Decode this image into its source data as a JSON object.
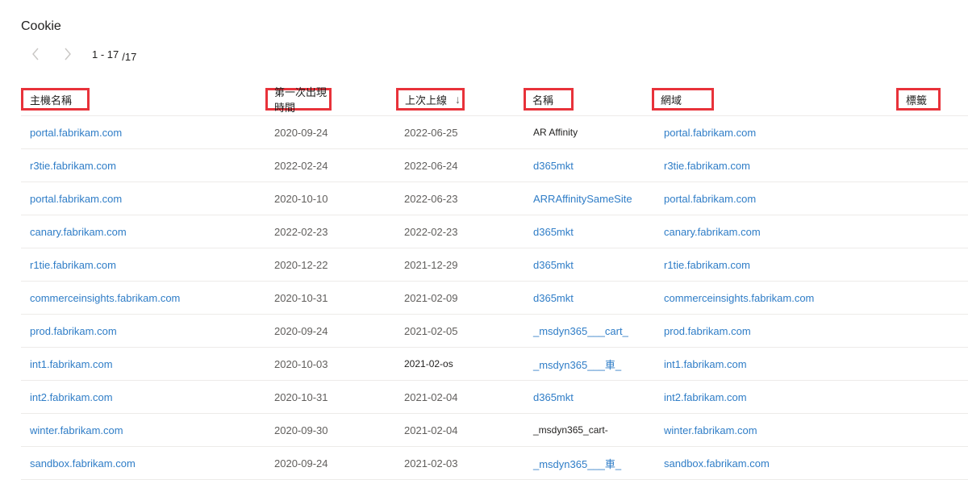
{
  "title": "Cookie",
  "pager": {
    "range": "1 - 17",
    "total": "/17"
  },
  "columns": {
    "host": "主機名稱",
    "first_seen": "第一次出現時間",
    "last_seen": "上次上線",
    "name": "名稱",
    "domain": "網域",
    "tags": "標籤"
  },
  "sort_indicator": "↓",
  "rows": [
    {
      "host": "portal.fabrikam.com",
      "first_seen": "2020-09-24",
      "last_seen": "2022-06-25",
      "name": "AR Affinity",
      "domain": "portal.fabrikam.com"
    },
    {
      "host": "r3tie.fabrikam.com",
      "first_seen": "2022-02-24",
      "last_seen": "2022-06-24",
      "name": "d365mkt",
      "domain": "r3tie.fabrikam.com"
    },
    {
      "host": "portal.fabrikam.com",
      "first_seen": "2020-10-10",
      "last_seen": "2022-06-23",
      "name": "ARRAffinitySameSite",
      "domain": "portal.fabrikam.com"
    },
    {
      "host": "canary.fabrikam.com",
      "first_seen": "2022-02-23",
      "last_seen": "2022-02-23",
      "name": "d365mkt",
      "domain": "canary.fabrikam.com"
    },
    {
      "host": "r1tie.fabrikam.com",
      "first_seen": "2020-12-22",
      "last_seen": "2021-12-29",
      "name": "d365mkt",
      "domain": "r1tie.fabrikam.com"
    },
    {
      "host": "commerceinsights.fabrikam.com",
      "first_seen": "2020-10-31",
      "last_seen": "2021-02-09",
      "name": "d365mkt",
      "domain": "commerceinsights.fabrikam.com"
    },
    {
      "host": "prod.fabrikam.com",
      "first_seen": "2020-09-24",
      "last_seen": "2021-02-05",
      "name": "_msdyn365___cart_",
      "domain": "prod.fabrikam.com"
    },
    {
      "host": "int1.fabrikam.com",
      "first_seen": "2020-10-03",
      "last_seen": "2021-02-os",
      "name": "_msdyn365___車_",
      "domain": "int1.fabrikam.com"
    },
    {
      "host": "int2.fabrikam.com",
      "first_seen": "2020-10-31",
      "last_seen": "2021-02-04",
      "name": "d365mkt",
      "domain": "int2.fabrikam.com"
    },
    {
      "host": "winter.fabrikam.com",
      "first_seen": "2020-09-30",
      "last_seen": "2021-02-04",
      "name": "_msdyn365_cart-",
      "domain": "winter.fabrikam.com"
    },
    {
      "host": "sandbox.fabrikam.com",
      "first_seen": "2020-09-24",
      "last_seen": "2021-02-03",
      "name": "_msdyn365___車_",
      "domain": "sandbox.fabrikam.com"
    }
  ],
  "colors": {
    "link": "#2f7dc7",
    "highlight": "#e8323a",
    "divider": "#edebe9"
  }
}
